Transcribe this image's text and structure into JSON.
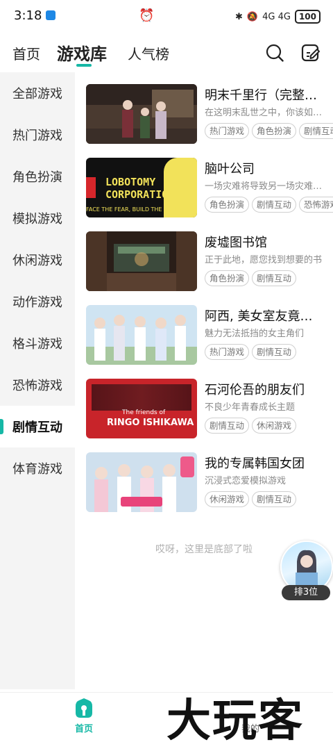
{
  "status": {
    "time": "3:18",
    "battery": "100",
    "signal": "4G 4G"
  },
  "nav": {
    "tabs": [
      "首页",
      "游戏库",
      "人气榜"
    ],
    "active_tab": "游戏库"
  },
  "sidebar": {
    "items": [
      "全部游戏",
      "热门游戏",
      "角色扮演",
      "模拟游戏",
      "休闲游戏",
      "动作游戏",
      "格斗游戏",
      "恐怖游戏",
      "剧情互动",
      "体育游戏"
    ],
    "active": "剧情互动"
  },
  "games": [
    {
      "title": "明末千里行（完整…",
      "desc": "在这明末乱世之中，你该如…",
      "tags": [
        "热门游戏",
        "角色扮演",
        "剧情互动"
      ],
      "thumb_text": ""
    },
    {
      "title": "脑叶公司",
      "desc": "一场灾难将导致另一场灾难…",
      "tags": [
        "角色扮演",
        "剧情互动",
        "恐怖游戏"
      ],
      "thumb_text": "LOBOTOMY CORPORATION",
      "thumb_sub": "FACE THE FEAR, BUILD THE FUTURE"
    },
    {
      "title": "废墟图书馆",
      "desc": "正于此地，愿您找到想要的书",
      "tags": [
        "角色扮演",
        "剧情互动"
      ],
      "thumb_text": ""
    },
    {
      "title": "阿西, 美女室友竟…",
      "desc": "魅力无法抵挡的女主角们",
      "tags": [
        "热门游戏",
        "剧情互动"
      ],
      "thumb_text": ""
    },
    {
      "title": "石河伦吾的朋友们",
      "desc": "不良少年青春成长主题",
      "tags": [
        "剧情互动",
        "休闲游戏"
      ],
      "thumb_text": "The friends of",
      "thumb_sub": "RINGO ISHIKAWA"
    },
    {
      "title": "我的专属韩国女团",
      "desc": "沉浸式恋爱模拟游戏",
      "tags": [
        "休闲游戏",
        "剧情互动"
      ],
      "thumb_text": ""
    }
  ],
  "footer_note": "哎呀，这里是底部了啦",
  "float_widget": {
    "rank_label": "排3位"
  },
  "bottom": {
    "home_label": "首页",
    "mine_label": "我的"
  },
  "watermark": "大玩客",
  "colors": {
    "accent": "#16b8a6"
  }
}
